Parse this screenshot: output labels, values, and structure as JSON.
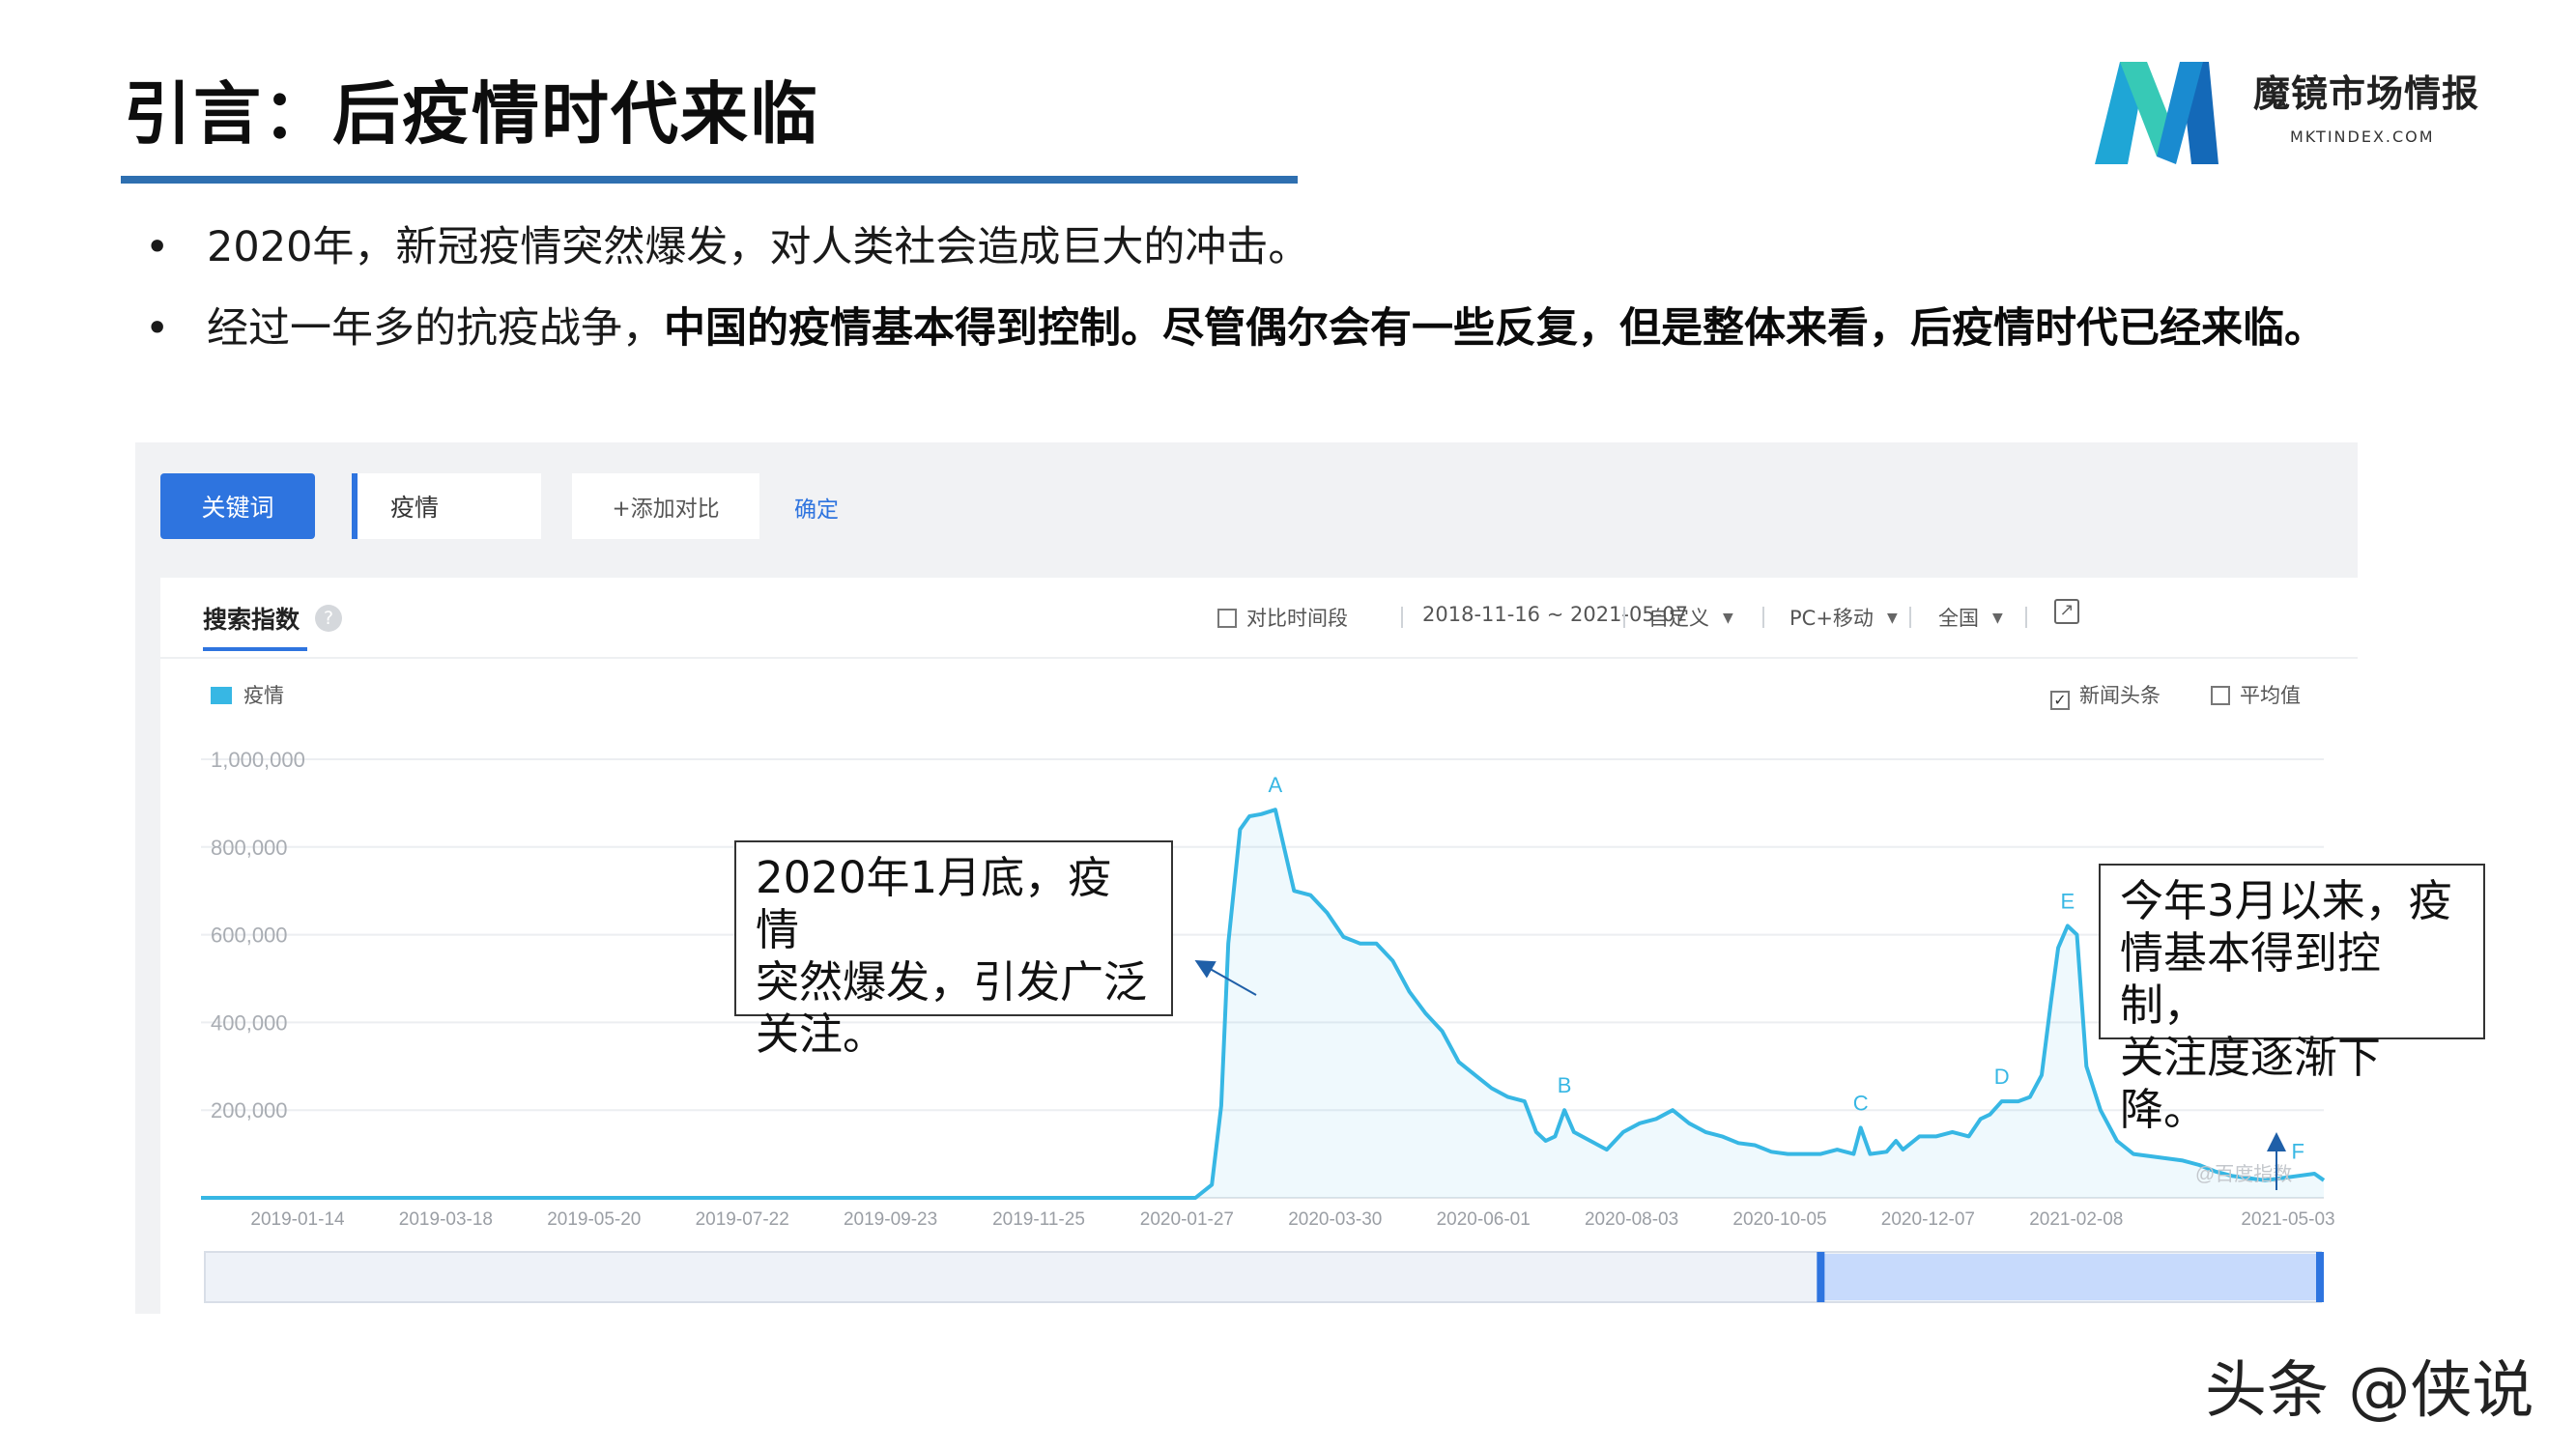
{
  "slide": {
    "title": "引言：后疫情时代来临",
    "bullets": [
      {
        "normal": "2020年，新冠疫情突然爆发，对人类社会造成巨大的冲击。",
        "bold": ""
      },
      {
        "normal": "经过一年多的抗疫战争，",
        "bold": "中国的疫情基本得到控制。尽管偶尔会有一些反复，但是整体来看，后疫情时代已经来临。"
      }
    ],
    "bullet_glyph": "•",
    "logo": {
      "name": "魔镜市场情报",
      "url": "MKTINDEX.COM",
      "colors": [
        "#1fa6d6",
        "#37c9b6",
        "#1469b8"
      ]
    },
    "watermark": "头条 @侠说"
  },
  "screenshot": {
    "keyword_button": "关键词",
    "search_term": "疫情",
    "add_compare": "+添加对比",
    "confirm": "确定",
    "panel_tab": "搜索指数",
    "help_icon": "?",
    "compare_period": "对比时间段",
    "date_range": "2018-11-16 ~ 2021-05-07",
    "custom": "自定义",
    "device": "PC+移动",
    "region": "全国",
    "news_headlines": "新闻头条",
    "news_checked": "✓",
    "average": "平均值",
    "legend_label": "疫情",
    "source_watermark": "@百度指数",
    "accent": "#2e74df",
    "series_color": "#37b7e4"
  },
  "callouts": {
    "left": [
      "2020年1月底，疫情",
      "突然爆发，引发广泛",
      "关注。"
    ],
    "right": [
      "今年3月以来，疫",
      "情基本得到控制，",
      "关注度逐渐下降。"
    ]
  },
  "chart_data": {
    "type": "area",
    "ylim": [
      0,
      1000000
    ],
    "y_ticks": [
      200000,
      400000,
      600000,
      800000,
      1000000
    ],
    "y_tick_labels": [
      "200,000",
      "400,000",
      "600,000",
      "800,000",
      "1,000,000"
    ],
    "x_tick_labels": [
      "2019-01-14",
      "2019-03-18",
      "2019-05-20",
      "2019-07-22",
      "2019-09-23",
      "2019-11-25",
      "2020-01-27",
      "2020-03-30",
      "2020-06-01",
      "2020-08-03",
      "2020-10-05",
      "2020-12-07",
      "2021-02-08",
      "2021-05-03"
    ],
    "series": [
      {
        "x": [
          "2018-11-16",
          "2019-06-01",
          "2020-01-13",
          "2020-01-20",
          "2020-01-24",
          "2020-01-27",
          "2020-02-01",
          "2020-02-05",
          "2020-02-10",
          "2020-02-16",
          "2020-02-24",
          "2020-03-02",
          "2020-03-09",
          "2020-03-16",
          "2020-03-23",
          "2020-03-30",
          "2020-04-06",
          "2020-04-13",
          "2020-04-20",
          "2020-04-27",
          "2020-05-04",
          "2020-05-11",
          "2020-05-18",
          "2020-05-25",
          "2020-06-01",
          "2020-06-06",
          "2020-06-10",
          "2020-06-14",
          "2020-06-18",
          "2020-06-22",
          "2020-06-29",
          "2020-07-06",
          "2020-07-13",
          "2020-07-20",
          "2020-07-27",
          "2020-08-03",
          "2020-08-10",
          "2020-08-17",
          "2020-08-24",
          "2020-08-31",
          "2020-09-07",
          "2020-09-14",
          "2020-09-21",
          "2020-09-28",
          "2020-10-05",
          "2020-10-12",
          "2020-10-19",
          "2020-10-22",
          "2020-10-26",
          "2020-11-02",
          "2020-11-06",
          "2020-11-09",
          "2020-11-16",
          "2020-11-23",
          "2020-11-30",
          "2020-12-07",
          "2020-12-12",
          "2020-12-16",
          "2020-12-21",
          "2020-12-28",
          "2021-01-02",
          "2021-01-07",
          "2021-01-11",
          "2021-01-14",
          "2021-01-18",
          "2021-01-22",
          "2021-01-26",
          "2021-02-01",
          "2021-02-08",
          "2021-02-15",
          "2021-02-22",
          "2021-03-01",
          "2021-03-08",
          "2021-03-15",
          "2021-03-22",
          "2021-03-29",
          "2021-04-05",
          "2021-04-12",
          "2021-04-19",
          "2021-04-26",
          "2021-05-03",
          "2021-05-07"
        ],
        "values": [
          0,
          0,
          0,
          30000,
          210000,
          580000,
          840000,
          870000,
          875000,
          885000,
          700000,
          690000,
          650000,
          595000,
          580000,
          580000,
          540000,
          470000,
          420000,
          380000,
          310000,
          280000,
          250000,
          230000,
          220000,
          150000,
          130000,
          140000,
          200000,
          150000,
          130000,
          110000,
          150000,
          170000,
          180000,
          200000,
          170000,
          150000,
          140000,
          125000,
          120000,
          105000,
          100000,
          100000,
          100000,
          110000,
          100000,
          160000,
          100000,
          105000,
          130000,
          110000,
          140000,
          140000,
          150000,
          140000,
          180000,
          190000,
          220000,
          220000,
          230000,
          280000,
          450000,
          570000,
          620000,
          600000,
          300000,
          200000,
          130000,
          100000,
          95000,
          90000,
          85000,
          75000,
          60000,
          50000,
          45000,
          40000,
          45000,
          50000,
          55000,
          40000
        ]
      }
    ],
    "annotations": [
      {
        "label": "A",
        "date": "2020-02-16"
      },
      {
        "label": "B",
        "date": "2020-06-18"
      },
      {
        "label": "C",
        "date": "2020-10-22"
      },
      {
        "label": "D",
        "date": "2020-12-21"
      },
      {
        "label": "E",
        "date": "2021-01-18"
      },
      {
        "label": "F",
        "date": "2021-04-26"
      }
    ],
    "range_selector": {
      "start": "2020-10-05",
      "end": "2021-05-07"
    },
    "grid": true
  }
}
